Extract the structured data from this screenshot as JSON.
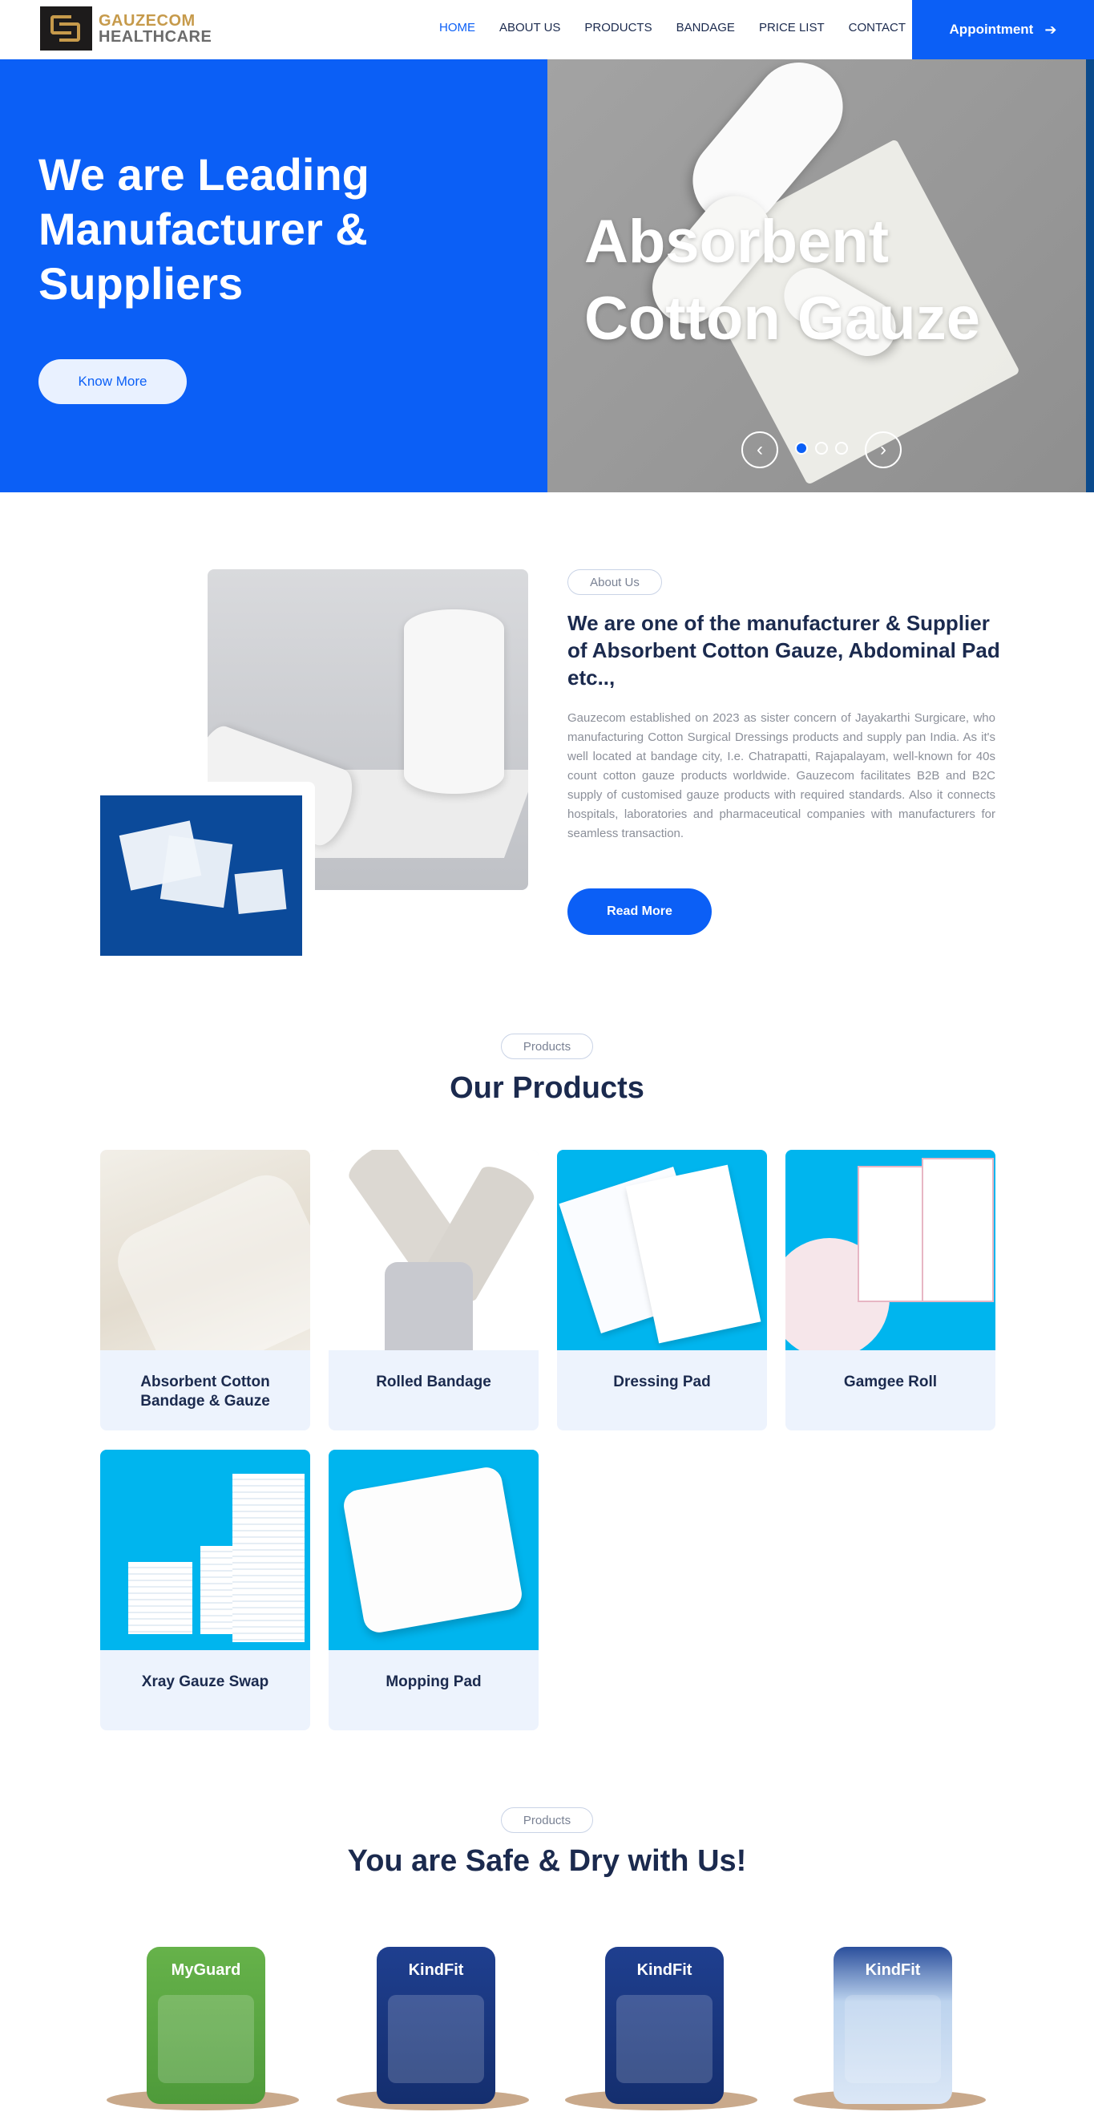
{
  "brand": {
    "line1": "GAUZECOM",
    "line2": "HEALTHCARE"
  },
  "nav": {
    "items": [
      "HOME",
      "ABOUT US",
      "PRODUCTS",
      "BANDAGE",
      "PRICE LIST",
      "CONTACT"
    ],
    "active": "HOME",
    "appointment_label": "Appointment",
    "colors": {
      "accent": "#0b5ff6",
      "text": "#1b2a4e"
    }
  },
  "hero": {
    "title": "We are Leading Manufacturer & Suppliers",
    "button_label": "Know More",
    "slide_title": "Absorbent Cotton Gauze",
    "slide_count": 3,
    "active_slide": 1,
    "prev_icon": "chevron-left-icon",
    "next_icon": "chevron-right-icon"
  },
  "about": {
    "pill": "About Us",
    "title": "We are one of the manufacturer & Supplier of Absorbent Cotton Gauze, Abdominal Pad etc..,",
    "text": "Gauzecom established on 2023 as sister concern of Jayakarthi Surgicare, who manufacturing Cotton Surgical Dressings products and supply pan India. As it's well located at bandage city, I.e. Chatrapatti, Rajapalayam, well-known for 40s count cotton gauze products worldwide. Gauzecom facilitates B2B and B2C supply of customised gauze products with required standards. Also it connects hospitals, laboratories and pharmaceutical companies with manufacturers for seamless transaction.",
    "button_label": "Read More"
  },
  "products": {
    "pill": "Products",
    "heading": "Our Products",
    "items": [
      {
        "name": "Absorbent Cotton Bandage & Gauze"
      },
      {
        "name": "Rolled Bandage"
      },
      {
        "name": "Dressing Pad"
      },
      {
        "name": "Gamgee Roll"
      },
      {
        "name": "Xray Gauze Swap"
      },
      {
        "name": "Mopping Pad"
      }
    ]
  },
  "safe": {
    "pill": "Products",
    "heading": "You are Safe & Dry with Us!",
    "packs": [
      {
        "label": "MyGuard"
      },
      {
        "label": "KindFit"
      },
      {
        "label": "KindFit"
      },
      {
        "label": "KindFit"
      }
    ]
  }
}
